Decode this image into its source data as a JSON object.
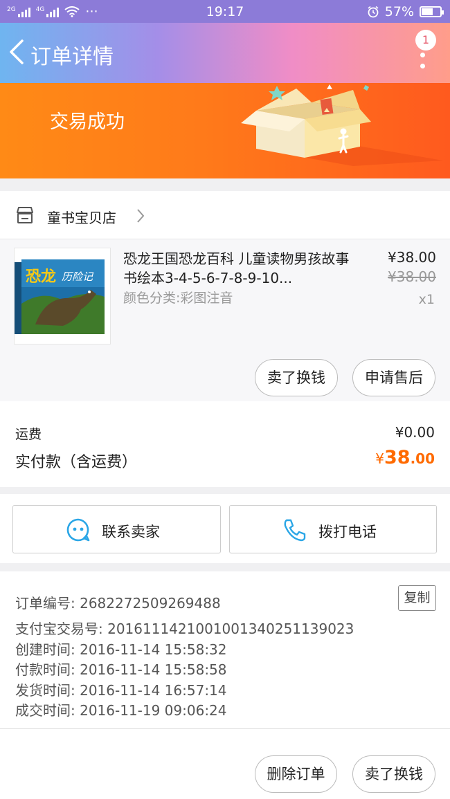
{
  "status_bar": {
    "network1": "2G",
    "network2": "4G",
    "dots": "···",
    "time": "19:17",
    "battery": "57%",
    "battery_level": 0.57
  },
  "header": {
    "title": "订单详情",
    "notification_count": "1"
  },
  "banner": {
    "status": "交易成功"
  },
  "shop": {
    "name": "童书宝贝店"
  },
  "product": {
    "title": "恐龙王国恐龙百科 儿童读物男孩故事书绘本3-4-5-6-7-8-9-10...",
    "sku": "颜色分类:彩图注音",
    "price": "¥38.00",
    "original_price": "¥38.00",
    "quantity": "x1",
    "cover_title": "恐龙",
    "cover_subtitle": "历险记",
    "buttons": {
      "sell": "卖了换钱",
      "after_sale": "申请售后"
    }
  },
  "fees": {
    "shipping_label": "运费",
    "shipping_value": "¥0.00",
    "paid_label": "实付款（含运费）",
    "paid_currency": "¥",
    "paid_integer": "38",
    "paid_decimal": ".00"
  },
  "contact": {
    "seller": "联系卖家",
    "phone": "拨打电话"
  },
  "order_info": {
    "order_no": "订单编号: 2682272509269488",
    "alipay_no": "支付宝交易号: 2016111421001001340251139023",
    "created": "创建时间: 2016-11-14 15:58:32",
    "paid": "付款时间: 2016-11-14 15:58:58",
    "shipped": "发货时间: 2016-11-14 16:57:14",
    "completed": "成交时间: 2016-11-19 09:06:24",
    "copy_label": "复制"
  },
  "footer": {
    "delete": "删除订单",
    "sell": "卖了换钱"
  },
  "colors": {
    "accent_orange": "#ff6a00",
    "banner_orange": "#ff7a1a",
    "contact_blue": "#2aa6e6"
  }
}
